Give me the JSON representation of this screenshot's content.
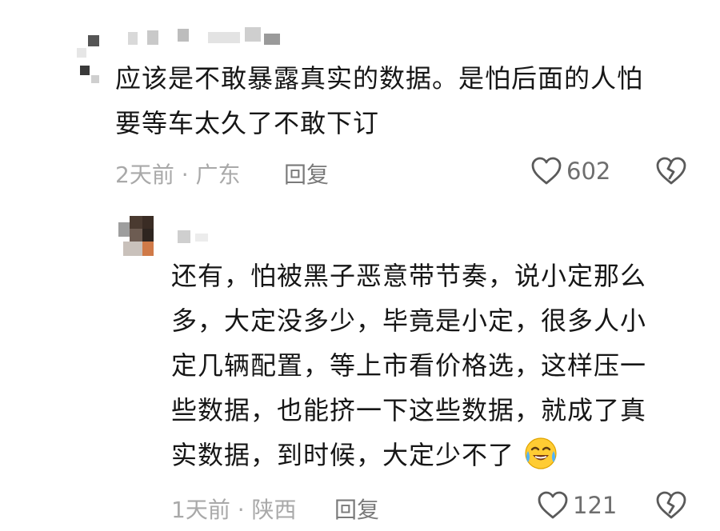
{
  "comments": [
    {
      "username": "",
      "text_line1": "应该是不敢暴露真实的数据。是怕后面的人怕",
      "text_line2": "要等车太久了不敢下订",
      "time": "2天前",
      "location": "广东",
      "separator": "·",
      "reply_label": "回复",
      "likes": "602"
    },
    {
      "username": "",
      "text_line1": "还有，怕被黑子恶意带节奏，说小定那么",
      "text_line2": "多，大定没多少，毕竟是小定，很多人小",
      "text_line3": "定几辆配置，等上市看价格选，这样压一",
      "text_line4": "些数据，也能挤一下这些数据，就成了真",
      "text_line5": "实数据，到时候，大定少不了",
      "emoji": "crying-laughing-emoji",
      "time": "1天前",
      "location": "陕西",
      "separator": "·",
      "reply_label": "回复",
      "likes": "121"
    }
  ],
  "colors": {
    "text": "#161616",
    "meta": "#a9a9a9",
    "reply": "#7a7a7a",
    "icon": "#5a5a5a"
  }
}
